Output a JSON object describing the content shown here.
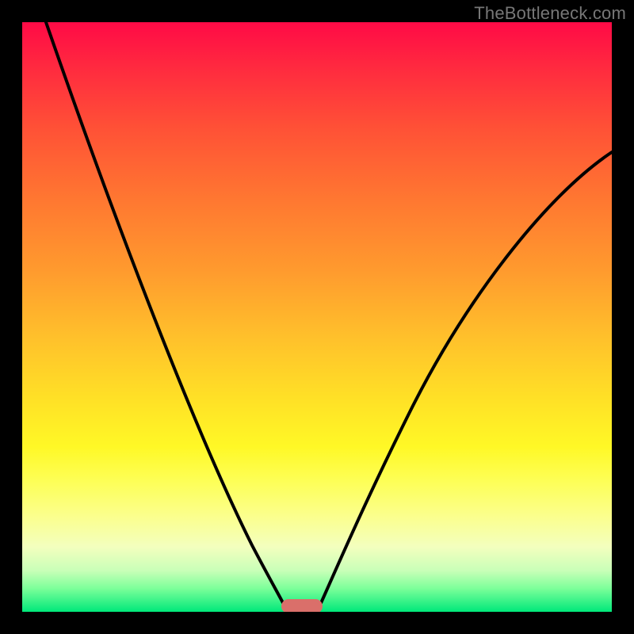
{
  "watermark": {
    "text": "TheBottleneck.com"
  },
  "chart_data": {
    "type": "line",
    "title": "",
    "xlabel": "",
    "ylabel": "",
    "xlim": [
      0,
      100
    ],
    "ylim": [
      0,
      100
    ],
    "grid": false,
    "legend": false,
    "gradient_stops": [
      {
        "pos": 0,
        "color": "#ff0a46"
      },
      {
        "pos": 18,
        "color": "#ff5136"
      },
      {
        "pos": 42,
        "color": "#ff9a2e"
      },
      {
        "pos": 64,
        "color": "#ffe126"
      },
      {
        "pos": 84,
        "color": "#fbff8f"
      },
      {
        "pos": 96,
        "color": "#7dff9a"
      },
      {
        "pos": 100,
        "color": "#00e87a"
      }
    ],
    "series": [
      {
        "name": "left-curve",
        "x": [
          4,
          8,
          12,
          16,
          20,
          24,
          28,
          32,
          36,
          40,
          42,
          44,
          45
        ],
        "values": [
          100,
          90,
          80,
          70,
          60,
          50,
          40,
          30,
          20,
          10,
          5,
          2,
          0
        ]
      },
      {
        "name": "right-curve",
        "x": [
          50,
          52,
          55,
          58,
          62,
          66,
          71,
          76,
          82,
          88,
          94,
          100
        ],
        "values": [
          0,
          5,
          12,
          19,
          27,
          34,
          42,
          49,
          57,
          64,
          71,
          78
        ]
      }
    ],
    "marker": {
      "name": "bottleneck-indicator",
      "x_start": 44,
      "x_end": 51,
      "y": 0,
      "color": "#da6f6a"
    }
  }
}
